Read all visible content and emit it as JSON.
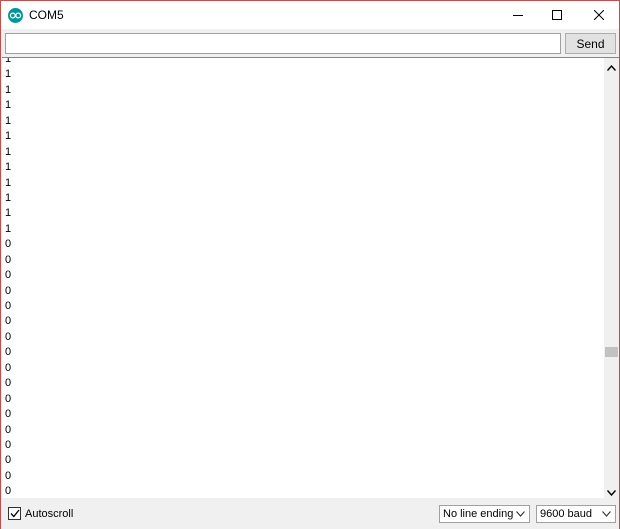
{
  "window": {
    "title": "COM5",
    "controls": [
      "minimize-icon",
      "maximize-icon",
      "close-icon"
    ]
  },
  "input": {
    "value": "",
    "placeholder": "",
    "send_label": "Send"
  },
  "output": {
    "lines": [
      "1",
      "1",
      "1",
      "1",
      "1",
      "1",
      "1",
      "1",
      "1",
      "1",
      "1",
      "1",
      "0",
      "0",
      "0",
      "0",
      "0",
      "0",
      "0",
      "0",
      "0",
      "0",
      "0",
      "0",
      "0",
      "0",
      "0",
      "0",
      "0",
      "0"
    ]
  },
  "statusbar": {
    "autoscroll_label": "Autoscroll",
    "autoscroll_checked": true,
    "line_ending": "No line ending",
    "baud_rate": "9600 baud"
  },
  "colors": {
    "window_border": "#c0504d",
    "app_icon": "#00979c",
    "chrome": "#f0f0f0"
  }
}
